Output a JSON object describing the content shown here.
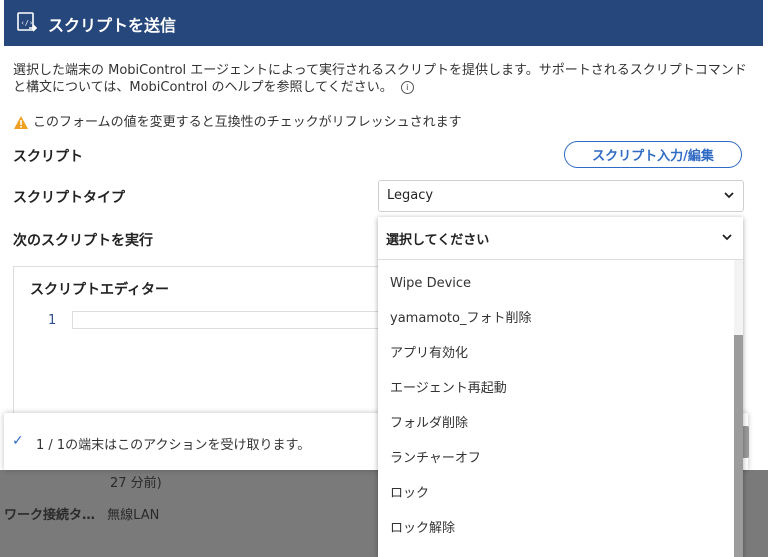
{
  "dialog": {
    "title": "スクリプトを送信",
    "description": "選択した端末の MobiControl エージェントによって実行されるスクリプトを提供します。サポートされるスクリプトコマンドと構文については、MobiControl のヘルプを参照してください。",
    "warning": "このフォームの値を変更すると互換性のチェックがリフレッシュされます",
    "script_label": "スクリプト",
    "script_edit_button": "スクリプト入力/編集",
    "script_type_label": "スクリプトタイプ",
    "script_type_value": "Legacy",
    "run_script_label": "次のスクリプトを実行",
    "run_script_value": "選択してください",
    "editor_title": "スクリプトエディター",
    "line_number": "1"
  },
  "dropdown": {
    "items": [
      "Wipe Device",
      "yamamoto_フォト削除",
      "アプリ有効化",
      "エージェント再起動",
      "フォルダ削除",
      "ランチャーオフ",
      "ロック",
      "ロック解除"
    ]
  },
  "toast": {
    "message": "1 / 1の端末はこのアクションを受け取ります。"
  },
  "background": {
    "row1_value": "27 分前)",
    "row2_key": "ワーク接続タ…",
    "row2_value": "無線LAN"
  },
  "colors": {
    "header_bg": "#26477b",
    "accent": "#2f6bc4",
    "warning": "#f0a020"
  }
}
